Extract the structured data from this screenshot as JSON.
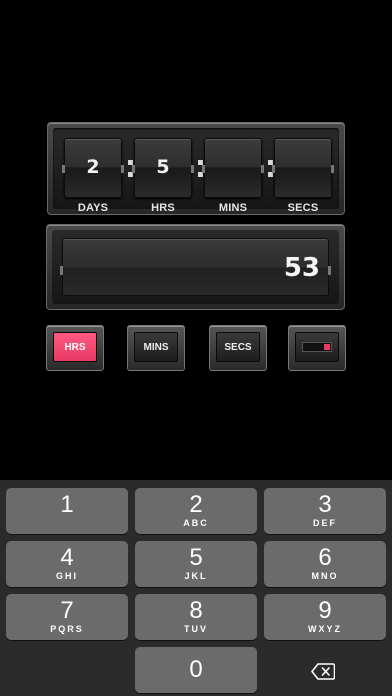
{
  "counter": {
    "days": "2",
    "hours": "5",
    "minutes": "",
    "seconds": "",
    "labels": {
      "days": "DAYS",
      "hours": "HRS",
      "minutes": "MINS",
      "seconds": "SECS"
    }
  },
  "display": {
    "value": "53"
  },
  "mode_buttons": {
    "hrs": "HRS",
    "mins": "MINS",
    "secs": "SECS",
    "active": "hrs",
    "accent_color": "#ff4f78"
  },
  "keypad": {
    "keys": [
      {
        "num": "1",
        "letters": ""
      },
      {
        "num": "2",
        "letters": "ABC"
      },
      {
        "num": "3",
        "letters": "DEF"
      },
      {
        "num": "4",
        "letters": "GHI"
      },
      {
        "num": "5",
        "letters": "JKL"
      },
      {
        "num": "6",
        "letters": "MNO"
      },
      {
        "num": "7",
        "letters": "PQRS"
      },
      {
        "num": "8",
        "letters": "TUV"
      },
      {
        "num": "9",
        "letters": "WXYZ"
      },
      {
        "num": "0",
        "letters": ""
      }
    ],
    "backspace_icon": "backspace-icon"
  }
}
